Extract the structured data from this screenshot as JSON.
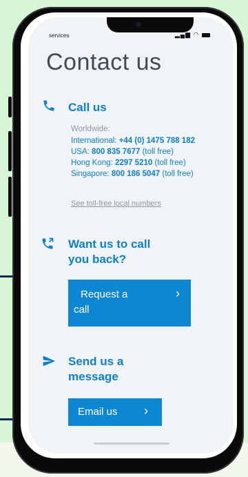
{
  "status": {
    "left_label": "services",
    "right_icons": "signal-wifi-battery"
  },
  "page": {
    "title": "Contact us"
  },
  "call_us": {
    "heading": "Call us",
    "icon": "phone-icon",
    "worldwide_label": "Worldwide:",
    "lines": [
      {
        "prefix": "International: ",
        "number": "+44 (0) 1475 788 182",
        "suffix": ""
      },
      {
        "prefix": "USA: ",
        "number": "800 835 7677",
        "suffix": " (toll free)"
      },
      {
        "prefix": "Hong Kong: ",
        "number": "2297 5210",
        "suffix": " (toll free)"
      },
      {
        "prefix": "Singapore: ",
        "number": "800 186 5047",
        "suffix": " (toll free)"
      }
    ],
    "local_numbers_link": "See toll-free local numbers"
  },
  "callback": {
    "heading_line1": "Want us to call",
    "heading_line2": "you back?",
    "icon": "phone-callback-icon",
    "button_line1": "Request a",
    "button_line2": "call",
    "button_chevron": "›"
  },
  "message": {
    "heading_line1": "Send us a",
    "heading_line2": "message",
    "icon": "paper-plane-icon",
    "button_label": "Email us",
    "button_chevron": "›"
  },
  "colors": {
    "accent": "#0e87d2",
    "background": "#d6f6d6",
    "pointer": "#0b2a55"
  }
}
